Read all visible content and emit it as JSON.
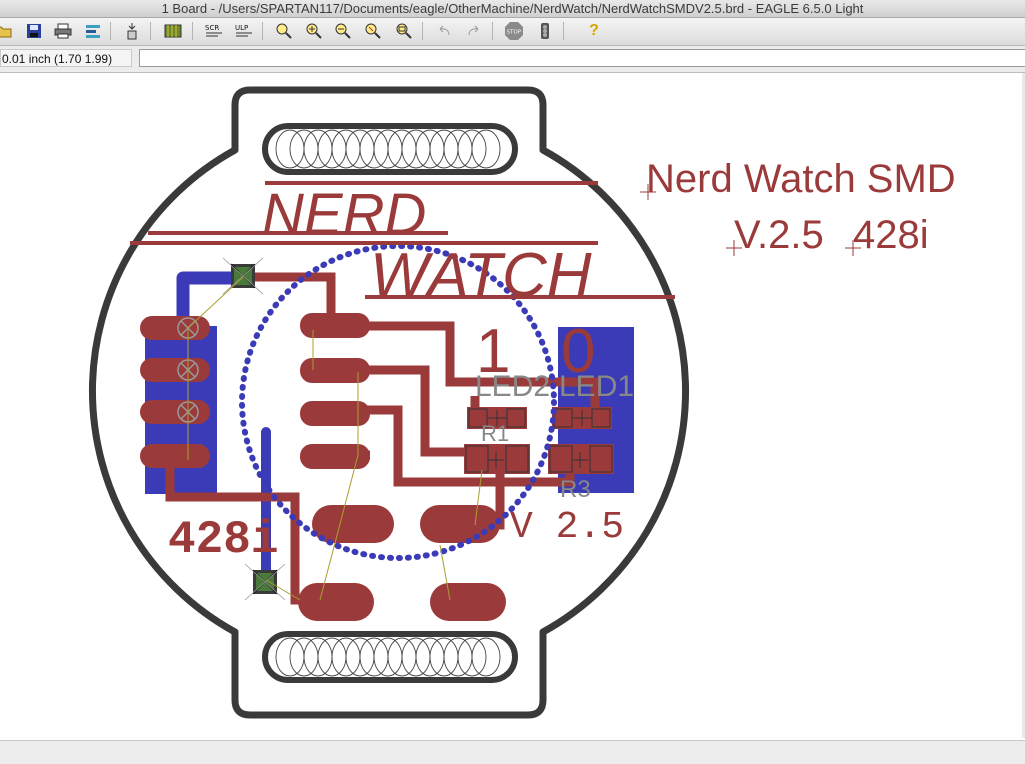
{
  "window": {
    "title": "1 Board - /Users/SPARTAN117/Documents/eagle/OtherMachine/NerdWatch/NerdWatchSMDV2.5.brd - EAGLE 6.5.0 Light"
  },
  "toolbar": {
    "buttons": [
      "open-icon",
      "save-icon",
      "print-icon",
      "cam-icon",
      "switch-icon",
      "script-icon",
      "ulp-icon",
      "zoom-fit-icon",
      "zoom-in-icon",
      "zoom-out-icon",
      "zoom-select-icon",
      "redraw-icon",
      "undo-icon",
      "redo-icon",
      "stop-icon",
      "go-icon",
      "help-icon"
    ],
    "script_label": "SCR",
    "ulp_label": "ULP",
    "stop_label": "STOP",
    "help_label": "?"
  },
  "commandbar": {
    "coordinate_display": "0.01 inch (1.70 1.99)",
    "command_value": ""
  },
  "board": {
    "silk_title_line1": "Nerd Watch SMD",
    "silk_title_line2": "V.2.5",
    "silk_title_line3": "428i",
    "logo_word1": "NERD",
    "logo_word2": "WATCH",
    "copper_428i": "428i",
    "copper_version": "V 2.5",
    "led_digit_left": "1",
    "led_digit_right": "0",
    "label_led2": "LED2",
    "label_led1": "LED1",
    "label_r1": "R1",
    "label_r3": "R3"
  },
  "colors": {
    "copper_top": "#9b3a3a",
    "copper_bottom": "#3b3bb8",
    "outline": "#3a3a3a",
    "silkscreen_label": "#888888",
    "airwire": "#a8a030",
    "via": "#4a7a3a"
  }
}
